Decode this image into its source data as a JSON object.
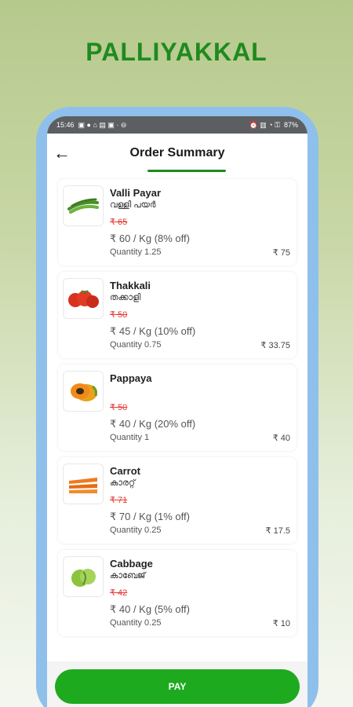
{
  "brand": "PALLIYAKKAL",
  "status": {
    "time": "15:46",
    "battery": "87%"
  },
  "header": {
    "title": "Order Summary",
    "back_icon": "←"
  },
  "items": [
    {
      "name": "Valli Payar",
      "local": "വള്ളി പയർ",
      "old_price": "₹ 65",
      "price": "₹ 60 / Kg (8% off)",
      "quantity": "Quantity 1.25",
      "total": "₹ 75",
      "icon": "long-beans-icon"
    },
    {
      "name": "Thakkali",
      "local": "തക്കാളി",
      "old_price": "₹ 50",
      "price": "₹ 45 / Kg (10% off)",
      "quantity": "Quantity 0.75",
      "total": "₹ 33.75",
      "icon": "tomato-icon"
    },
    {
      "name": "Pappaya",
      "local": "",
      "old_price": "₹ 50",
      "price": "₹ 40 / Kg (20% off)",
      "quantity": "Quantity 1",
      "total": "₹ 40",
      "icon": "papaya-icon"
    },
    {
      "name": "Carrot",
      "local": "കാരറ്റ്",
      "old_price": "₹ 71",
      "price": "₹ 70 / Kg (1% off)",
      "quantity": "Quantity 0.25",
      "total": "₹ 17.5",
      "icon": "carrot-icon"
    },
    {
      "name": "Cabbage",
      "local": "കാബേജ്",
      "old_price": "₹ 42",
      "price": "₹ 40 / Kg (5% off)",
      "quantity": "Quantity 0.25",
      "total": "₹ 10",
      "icon": "cabbage-icon"
    }
  ],
  "pay_label": "PAY",
  "colors": {
    "brand": "#1f8a1f",
    "pay_button": "#1eaa1e",
    "strike_price": "#e53935",
    "phone_frame": "#8fc0ec"
  }
}
